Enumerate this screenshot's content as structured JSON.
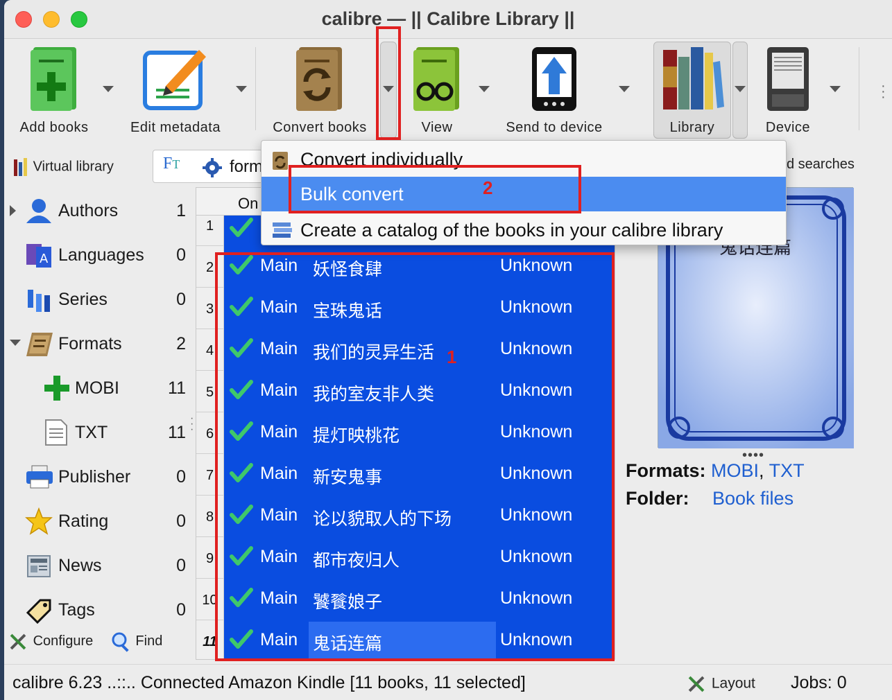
{
  "window": {
    "title": "calibre — || Calibre Library ||"
  },
  "toolbar": {
    "add_books": "Add books",
    "edit_metadata": "Edit metadata",
    "convert_books": "Convert books",
    "view": "View",
    "send_to_device": "Send to device",
    "library": "Library",
    "device": "Device"
  },
  "filterbar": {
    "virtual_library": "Virtual library",
    "search_text": "form",
    "saved_searches": "d searches"
  },
  "sidebar": {
    "items": [
      {
        "name": "Authors",
        "count": "1"
      },
      {
        "name": "Languages",
        "count": "0"
      },
      {
        "name": "Series",
        "count": "0"
      },
      {
        "name": "Formats",
        "count": "2"
      },
      {
        "name": "MOBI",
        "count": "11"
      },
      {
        "name": "TXT",
        "count": "11"
      },
      {
        "name": "Publisher",
        "count": "0"
      },
      {
        "name": "Rating",
        "count": "0"
      },
      {
        "name": "News",
        "count": "0"
      },
      {
        "name": "Tags",
        "count": "0"
      }
    ],
    "configure": "Configure",
    "find": "Find"
  },
  "booklist": {
    "header_on": "On",
    "rows": [
      {
        "num": "1",
        "library": "",
        "title": "",
        "author": ""
      },
      {
        "num": "2",
        "library": "Main",
        "title": "妖怪食肆",
        "author": "Unknown"
      },
      {
        "num": "3",
        "library": "Main",
        "title": "宝珠鬼话",
        "author": "Unknown"
      },
      {
        "num": "4",
        "library": "Main",
        "title": "我们的灵异生活",
        "author": "Unknown"
      },
      {
        "num": "5",
        "library": "Main",
        "title": "我的室友非人类",
        "author": "Unknown"
      },
      {
        "num": "6",
        "library": "Main",
        "title": "提灯映桃花",
        "author": "Unknown"
      },
      {
        "num": "7",
        "library": "Main",
        "title": "新安鬼事",
        "author": "Unknown"
      },
      {
        "num": "8",
        "library": "Main",
        "title": "论以貌取人的下场",
        "author": "Unknown"
      },
      {
        "num": "9",
        "library": "Main",
        "title": "都市夜归人",
        "author": "Unknown"
      },
      {
        "num": "10",
        "library": "Main",
        "title": "饕餮娘子",
        "author": "Unknown"
      },
      {
        "num": "11",
        "library": "Main",
        "title": "鬼话连篇",
        "author": "Unknown"
      }
    ]
  },
  "cover": {
    "title_text": "鬼话连篇"
  },
  "details": {
    "formats_label": "Formats:",
    "format_1": "MOBI",
    "format_sep": ",",
    "format_2": "TXT",
    "folder_label": "Folder:",
    "folder_link": "Book files"
  },
  "menu": {
    "items": [
      {
        "label": "Convert individually"
      },
      {
        "label": "Bulk convert"
      },
      {
        "label": "Create a catalog of the books in your calibre library"
      }
    ]
  },
  "annotations": {
    "one": "1",
    "two": "2"
  },
  "statusbar": {
    "left": "calibre 6.23 ..::.. Connected Amazon Kindle    [11 books, 11 selected]",
    "layout": "Layout",
    "jobs": "Jobs: 0"
  },
  "colors": {
    "selection": "#0a4de0",
    "menu_highlight": "#4b8cf0",
    "annotation_red": "#e02020"
  }
}
